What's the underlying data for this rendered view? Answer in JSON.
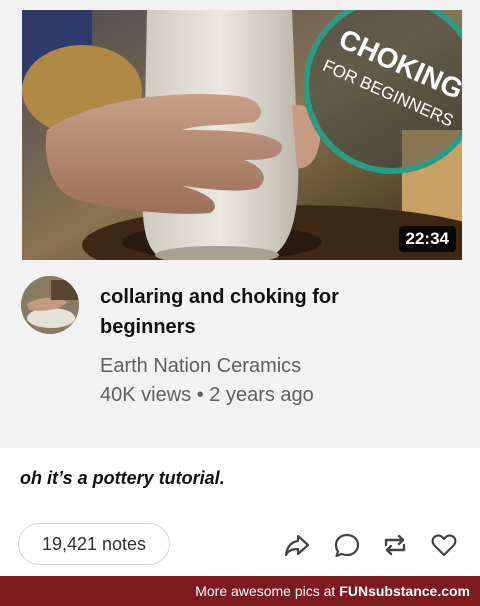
{
  "video": {
    "thumbnail_overlay": {
      "line1": "CHOKING",
      "line2": "FOR BEGINNERS"
    },
    "duration": "22:34",
    "title": "collaring and choking for beginners",
    "channel": "Earth Nation Ceramics",
    "meta": "40K views • 2 years ago"
  },
  "post": {
    "caption": "oh it’s a pottery tutorial.",
    "notes": "19,421 notes",
    "actions": [
      "share-icon",
      "reply-icon",
      "reblog-icon",
      "like-icon"
    ]
  },
  "footer": {
    "text": "More awesome pics at",
    "brand": "FUNsubstance.com",
    "color": "#7d1a1d"
  }
}
